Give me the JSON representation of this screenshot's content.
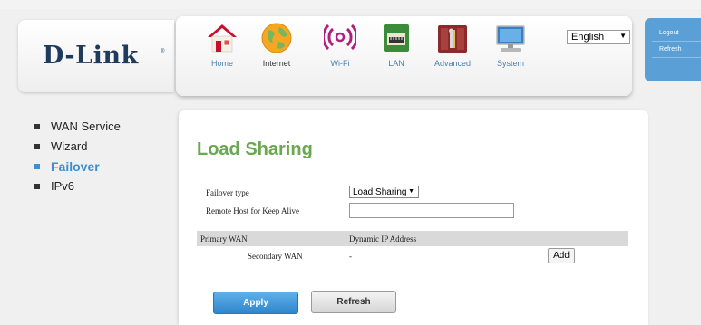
{
  "brand": {
    "logo": "D-Link",
    "registered_mark": "®"
  },
  "nav": {
    "items": [
      {
        "label": "Home",
        "icon": "home-icon"
      },
      {
        "label": "Internet",
        "icon": "globe-icon"
      },
      {
        "label": "Wi-Fi",
        "icon": "wifi-icon"
      },
      {
        "label": "LAN",
        "icon": "lan-icon"
      },
      {
        "label": "Advanced",
        "icon": "advanced-icon"
      },
      {
        "label": "System",
        "icon": "monitor-icon"
      }
    ]
  },
  "language": {
    "selected": "English"
  },
  "account": {
    "logout": "Logout",
    "refresh": "Refresh"
  },
  "sidebar": {
    "items": [
      {
        "label": "WAN Service"
      },
      {
        "label": "Wizard"
      },
      {
        "label": "Failover",
        "active": true
      },
      {
        "label": "IPv6"
      }
    ]
  },
  "content": {
    "title": "Load Sharing",
    "failover_type_label": "Failover type",
    "failover_type_value": "Load Sharing",
    "remote_host_label": "Remote Host for Keep Alive",
    "remote_host_value": "",
    "primary_wan_label": "Primary WAN",
    "primary_wan_value": "Dynamic IP Address",
    "secondary_wan_label": "Secondary WAN",
    "secondary_wan_value": "-",
    "add_label": "Add",
    "apply_label": "Apply",
    "refresh_label": "Refresh"
  },
  "colors": {
    "accent_blue": "#3b8fd0",
    "title_green": "#6aa84f",
    "logo_navy": "#1f3b5c"
  }
}
